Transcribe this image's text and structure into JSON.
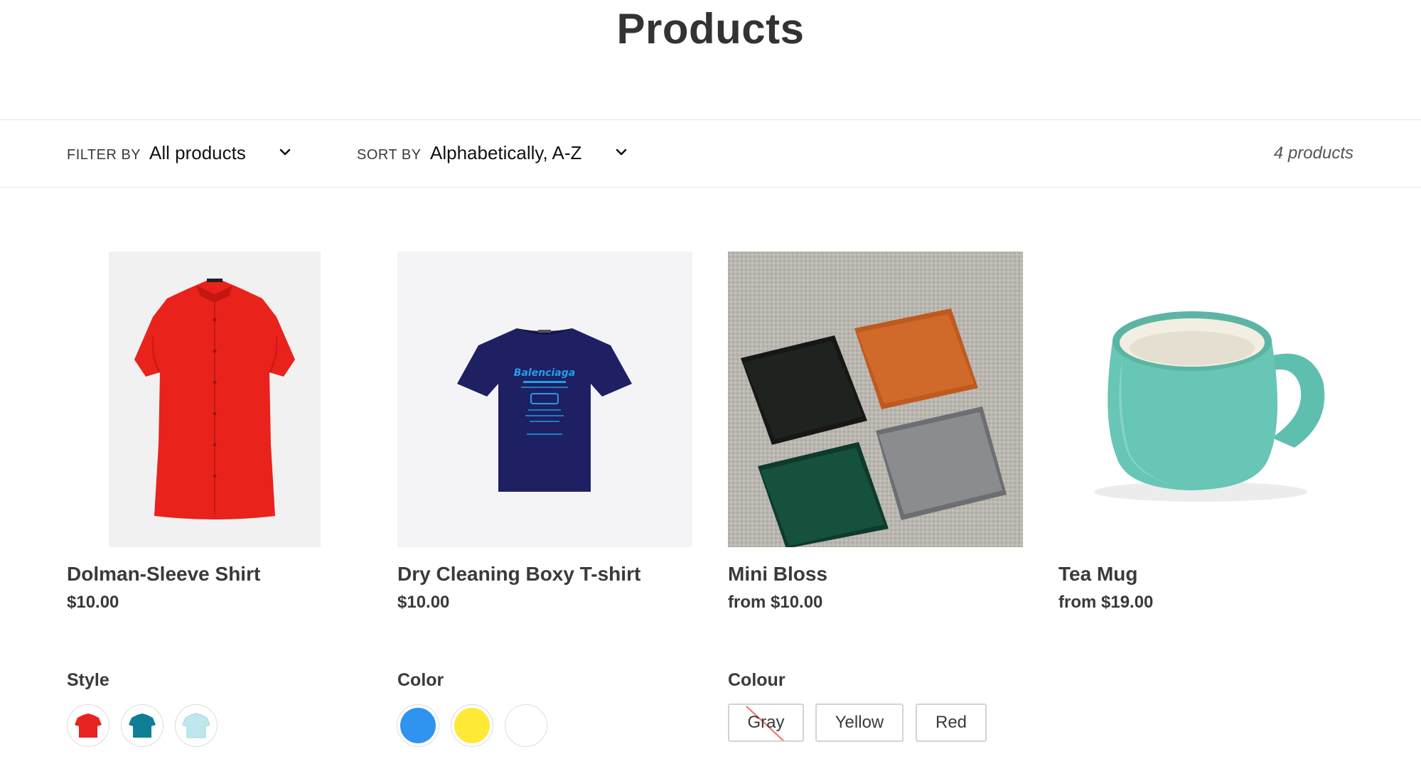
{
  "page": {
    "title": "Products"
  },
  "toolbar": {
    "filter_label": "FILTER BY",
    "filter_value": "All products",
    "sort_label": "SORT BY",
    "sort_value": "Alphabetically, A-Z",
    "product_count": "4 products"
  },
  "products": [
    {
      "title": "Dolman-Sleeve Shirt",
      "price": "$10.00",
      "image": "red-shirt-image"
    },
    {
      "title": "Dry Cleaning Boxy T-shirt",
      "price": "$10.00",
      "image": "navy-tshirt-image",
      "print": "Balenciaga"
    },
    {
      "title": "Mini Bloss",
      "price": "from $10.00",
      "image": "wallets-image"
    },
    {
      "title": "Tea Mug",
      "price": "from $19.00",
      "image": "teal-mug-image"
    }
  ],
  "options": {
    "style": {
      "label": "Style",
      "swatches": [
        "red",
        "teal",
        "light blue"
      ],
      "colors": [
        "#e8231f",
        "#0e7f95",
        "#bfe7ee"
      ]
    },
    "color": {
      "label": "Color",
      "swatches": [
        "blue",
        "yellow",
        "white"
      ],
      "colors": [
        "#2f93f0",
        "#fde936",
        "#ffffff"
      ]
    },
    "colour": {
      "label": "Colour",
      "values": [
        "Gray",
        "Yellow",
        "Red"
      ],
      "unavailable": "Gray"
    }
  },
  "colors": {
    "text": "#3a3a3a",
    "border": "#e6e6e6",
    "strike": "#f26b6b"
  }
}
